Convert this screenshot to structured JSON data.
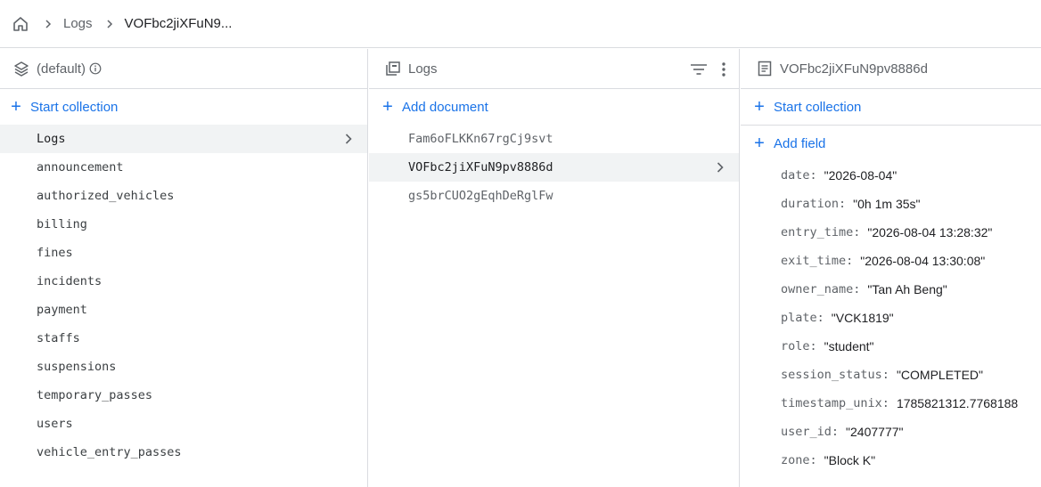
{
  "breadcrumb": {
    "items": [
      "Logs",
      "VOFbc2jiXFuN9..."
    ]
  },
  "panel1": {
    "title": "(default)",
    "action": "Start collection",
    "collections": [
      "Logs",
      "announcement",
      "authorized_vehicles",
      "billing",
      "fines",
      "incidents",
      "payment",
      "staffs",
      "suspensions",
      "temporary_passes",
      "users",
      "vehicle_entry_passes"
    ],
    "selected": "Logs"
  },
  "panel2": {
    "title": "Logs",
    "action": "Add document",
    "documents": [
      "Fam6oFLKKn67rgCj9svt",
      "VOFbc2jiXFuN9pv8886d",
      "gs5brCUO2gEqhDeRglFw"
    ],
    "selected": "VOFbc2jiXFuN9pv8886d"
  },
  "panel3": {
    "title": "VOFbc2jiXFuN9pv8886d",
    "action_collection": "Start collection",
    "action_field": "Add field",
    "fields": [
      {
        "key": "date",
        "value": "\"2026-08-04\""
      },
      {
        "key": "duration",
        "value": "\"0h 1m 35s\""
      },
      {
        "key": "entry_time",
        "value": "\"2026-08-04 13:28:32\""
      },
      {
        "key": "exit_time",
        "value": "\"2026-08-04 13:30:08\""
      },
      {
        "key": "owner_name",
        "value": "\"Tan Ah Beng\""
      },
      {
        "key": "plate",
        "value": "\"VCK1819\""
      },
      {
        "key": "role",
        "value": "\"student\""
      },
      {
        "key": "session_status",
        "value": "\"COMPLETED\""
      },
      {
        "key": "timestamp_unix",
        "value": "1785821312.7768188"
      },
      {
        "key": "user_id",
        "value": "\"2407777\""
      },
      {
        "key": "zone",
        "value": "\"Block K\""
      }
    ]
  },
  "icons": {
    "home": "home-icon",
    "database": "database-stack-icon",
    "info": "info-icon",
    "collection": "collection-icon",
    "filter": "filter-icon",
    "more": "more-vert-icon",
    "document": "document-icon",
    "chevron": "chevron-right-icon"
  },
  "colors": {
    "accent": "#1a73e8",
    "selected_bg": "#f1f3f4",
    "border": "#dadce0"
  }
}
